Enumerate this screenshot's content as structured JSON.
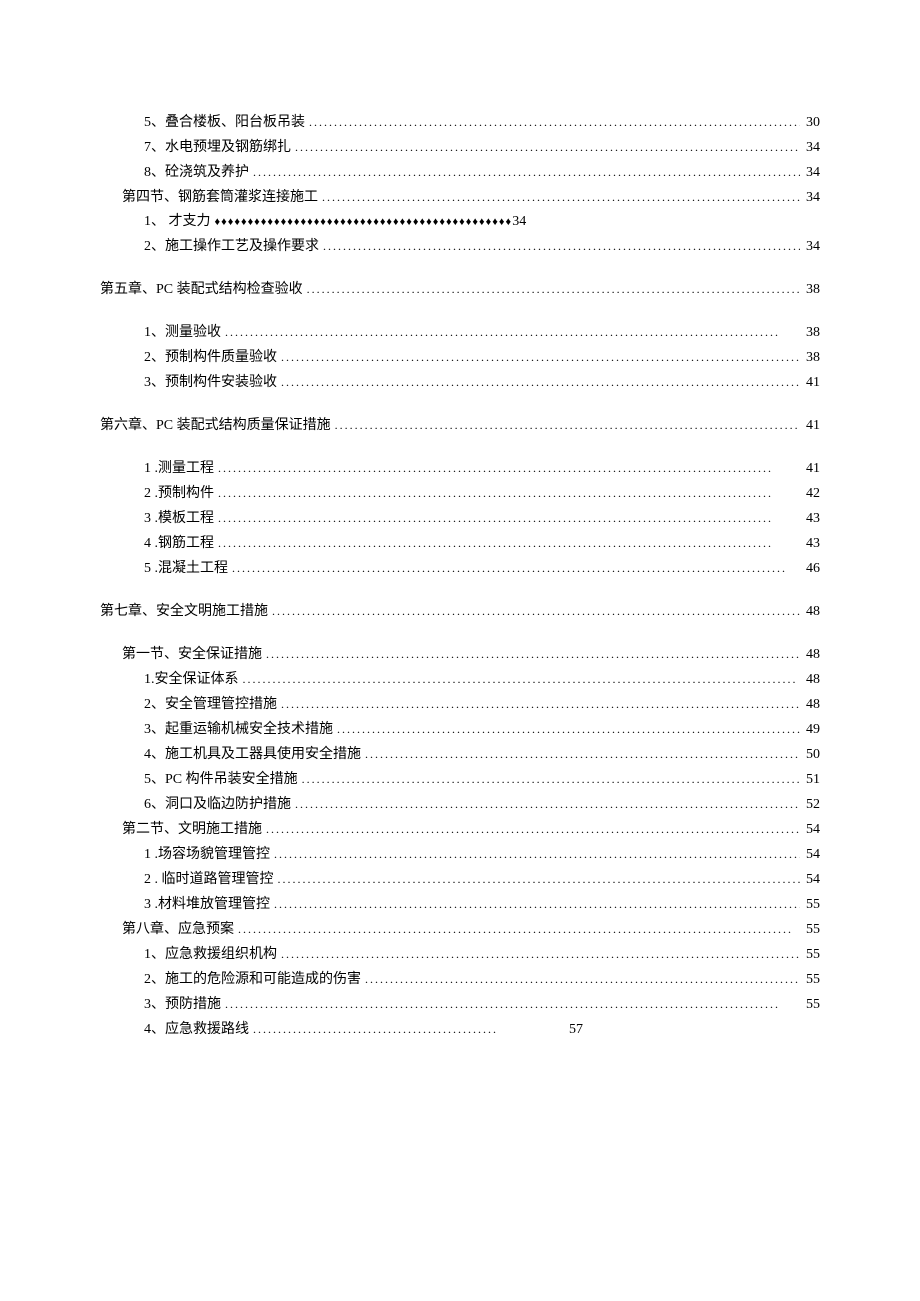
{
  "toc": [
    {
      "type": "entry",
      "indent": 2,
      "label": "5、叠合楼板、阳台板吊装",
      "fill": "dots",
      "page": "30"
    },
    {
      "type": "entry",
      "indent": 2,
      "label": "7、水电预埋及钢筋绑扎",
      "fill": "dots",
      "page": "34"
    },
    {
      "type": "entry",
      "indent": 2,
      "label": "8、砼浇筑及养护",
      "fill": "dots",
      "page": "34"
    },
    {
      "type": "entry",
      "indent": 1,
      "label": "第四节、钢筋套筒灌浆连接施工",
      "fill": "dots",
      "page": "34"
    },
    {
      "type": "diamond",
      "indent": 2,
      "label": "1、 才支力",
      "page": "34"
    },
    {
      "type": "entry",
      "indent": 2,
      "label": "2、施工操作工艺及操作要求",
      "fill": "dots",
      "page": "34"
    },
    {
      "type": "gap"
    },
    {
      "type": "entry",
      "indent": 0,
      "label": "第五章、PC 装配式结构检查验收",
      "fill": "dots",
      "page": "38"
    },
    {
      "type": "gap"
    },
    {
      "type": "entry",
      "indent": 2,
      "label": "1、测量验收",
      "fill": "dots",
      "page": "38"
    },
    {
      "type": "entry",
      "indent": 2,
      "label": "2、预制构件质量验收",
      "fill": "dots",
      "page": "38"
    },
    {
      "type": "entry",
      "indent": 2,
      "label": "3、预制构件安装验收",
      "fill": "dots",
      "page": "41"
    },
    {
      "type": "gap"
    },
    {
      "type": "entry",
      "indent": 0,
      "label": "第六章、PC 装配式结构质量保证措施",
      "fill": "dots",
      "page": "41"
    },
    {
      "type": "gap"
    },
    {
      "type": "entry",
      "indent": 2,
      "label": "1   .测量工程",
      "fill": "dots",
      "page": "41"
    },
    {
      "type": "entry",
      "indent": 2,
      "label": "2   .预制构件",
      "fill": "dots",
      "page": "42"
    },
    {
      "type": "entry",
      "indent": 2,
      "label": "3   .模板工程",
      "fill": "dots",
      "page": "43"
    },
    {
      "type": "entry",
      "indent": 2,
      "label": "4   .钢筋工程",
      "fill": "dots",
      "page": "43"
    },
    {
      "type": "entry",
      "indent": 2,
      "label": "5   .混凝土工程",
      "fill": "dots",
      "page": "46"
    },
    {
      "type": "gap"
    },
    {
      "type": "entry",
      "indent": 0,
      "label": "第七章、安全文明施工措施",
      "fill": "dots",
      "page": "48"
    },
    {
      "type": "gap"
    },
    {
      "type": "entry",
      "indent": 1,
      "label": "第一节、安全保证措施",
      "fill": "dots",
      "page": "48"
    },
    {
      "type": "entry",
      "indent": 2,
      "label": "1.安全保证体系",
      "fill": "dots",
      "page": "48"
    },
    {
      "type": "entry",
      "indent": 2,
      "label": "2、安全管理管控措施",
      "fill": "dots",
      "page": "48"
    },
    {
      "type": "entry",
      "indent": 2,
      "label": "3、起重运输机械安全技术措施",
      "fill": "dots",
      "page": "49"
    },
    {
      "type": "entry",
      "indent": 2,
      "label": "4、施工机具及工器具使用安全措施",
      "fill": "dots",
      "page": "50"
    },
    {
      "type": "entry",
      "indent": 2,
      "label": "5、PC 构件吊装安全措施",
      "fill": "dots",
      "page": "51"
    },
    {
      "type": "entry",
      "indent": 2,
      "label": "6、洞口及临边防护措施",
      "fill": "dots",
      "page": "52"
    },
    {
      "type": "entry",
      "indent": 1,
      "label": "第二节、文明施工措施",
      "fill": "dots",
      "page": "54"
    },
    {
      "type": "entry",
      "indent": 2,
      "label": "1   .场容场貌管理管控",
      "fill": "dots",
      "page": "54"
    },
    {
      "type": "entry",
      "indent": 2,
      "label": "2   . 临时道路管理管控",
      "fill": "dots",
      "page": "54"
    },
    {
      "type": "entry",
      "indent": 2,
      "label": "3   .材料堆放管理管控",
      "fill": "dots",
      "page": "55"
    },
    {
      "type": "entry",
      "indent": 1,
      "label": "第八章、应急预案",
      "fill": "dots",
      "page": "55"
    },
    {
      "type": "entry",
      "indent": 2,
      "label": "1、应急救援组织机构",
      "fill": "dots",
      "page": "55"
    },
    {
      "type": "entry",
      "indent": 2,
      "label": "2、施工的危险源和可能造成的伤害",
      "fill": "dots",
      "page": "55"
    },
    {
      "type": "entry",
      "indent": 2,
      "label": "3、预防措施",
      "fill": "dots",
      "page": "55"
    },
    {
      "type": "short",
      "indent": 2,
      "label": "4、应急救援路线",
      "page": "57"
    }
  ],
  "fillers": {
    "dots": "...............................................................................................................",
    "diamonds": "♦♦♦♦♦♦♦♦♦♦♦♦♦♦♦♦♦♦♦♦♦♦♦♦♦♦♦♦♦♦♦♦♦♦♦♦♦♦♦♦♦♦♦♦♦♦♦♦♦♦♦♦♦♦♦♦♦♦♦♦♦♦♦♦♦♦♦♦♦♦♦♦♦♦♦♦♦♦",
    "short_dots": "................................................."
  }
}
